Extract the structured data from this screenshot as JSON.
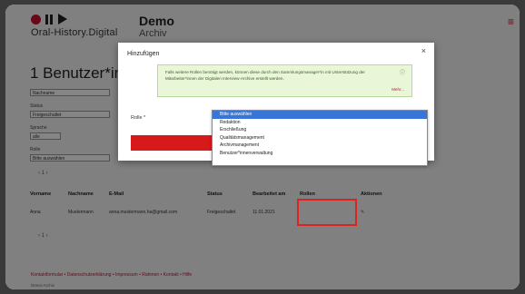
{
  "header": {
    "brand_line": "Oral-History.Digital",
    "demo": "Demo",
    "archiv": "Archiv",
    "menu_icon": "≡"
  },
  "page": {
    "title": "1 Benutzer*inn",
    "filters": [
      {
        "label": "",
        "value": "Nachname"
      },
      {
        "label": "Status",
        "value": "Freigeschaltet"
      },
      {
        "label": "Sprache",
        "value": "alle"
      },
      {
        "label": "Rolle",
        "value": "Bitte auswählen"
      }
    ],
    "pager": "‹  1  ›"
  },
  "table": {
    "headers": [
      "Vorname",
      "Nachname",
      "E-Mail",
      "Status",
      "Bearbeitet am",
      "Rollen",
      "Aktionen"
    ],
    "rows": [
      {
        "vorname": "Anna",
        "nachname": "Mustermann",
        "email": "anna.mustermann.ha@gmail.com",
        "status": "Freigeschaltet",
        "bearbeitet": "11.01.2021",
        "rollen": "",
        "aktion": "✎"
      }
    ]
  },
  "footer": {
    "links": "Kontaktformular  •  Datenschutzerklärung  •  Impressum  •  Rahmen  •  Kontakt  •  Hilfe",
    "copy": "Demo-Archiv"
  },
  "modal": {
    "title": "Hinzufügen",
    "close": "×",
    "info_text": "Falls weitere Rollen benötigt werden, können diese durch den Sammlungsmanager*in mit Unterstützung der Mitarbeiter*innen der Digitalen Interview-Archive erstellt werden.",
    "info_icon": "ⓘ",
    "more": "Mehr...",
    "rolle_label": "Rolle *"
  },
  "dropdown": {
    "options": [
      "Bitte auswählen",
      "Redaktion",
      "Erschließung",
      "Qualitätsmanagement",
      "Archivmanagement",
      "Benutzer*innenverwaltung"
    ],
    "selected_index": 0
  }
}
